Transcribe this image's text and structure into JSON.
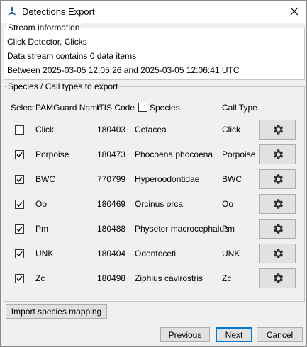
{
  "window": {
    "title": "Detections Export"
  },
  "stream": {
    "legend": "Stream information",
    "detector": "Click Detector, Clicks",
    "items": "Data stream contains 0 data items",
    "range": "Between 2025-03-05 12:05:26 and 2025-03-05 12:06:41 UTC"
  },
  "species": {
    "legend": "Species / Call types to export",
    "headers": {
      "select": "Select",
      "pamguard_name": "PAMGuard Name",
      "itis_code": "ITIS Code",
      "species": "Species",
      "call_type": "Call Type"
    },
    "species_header_checked": false,
    "rows": [
      {
        "selected": false,
        "name": "Click",
        "itis": "180403",
        "species": "Cetacea",
        "call_type": "Click"
      },
      {
        "selected": true,
        "name": "Porpoise",
        "itis": "180473",
        "species": "Phocoena phocoena",
        "call_type": "Porpoise"
      },
      {
        "selected": true,
        "name": "BWC",
        "itis": "770799",
        "species": "Hyperoodontidae",
        "call_type": "BWC"
      },
      {
        "selected": true,
        "name": "Oo",
        "itis": "180469",
        "species": "Orcinus orca",
        "call_type": "Oo"
      },
      {
        "selected": true,
        "name": "Pm",
        "itis": "180488",
        "species": "Physeter macrocephalus",
        "call_type": "Pm"
      },
      {
        "selected": true,
        "name": "UNK",
        "itis": "180404",
        "species": "Odontoceti",
        "call_type": "UNK"
      },
      {
        "selected": true,
        "name": "Zc",
        "itis": "180498",
        "species": "Ziphius cavirostris",
        "call_type": "Zc"
      }
    ],
    "row_icon": "gear-icon"
  },
  "buttons": {
    "import": "Import species mapping",
    "previous": "Previous",
    "next": "Next",
    "cancel": "Cancel"
  }
}
